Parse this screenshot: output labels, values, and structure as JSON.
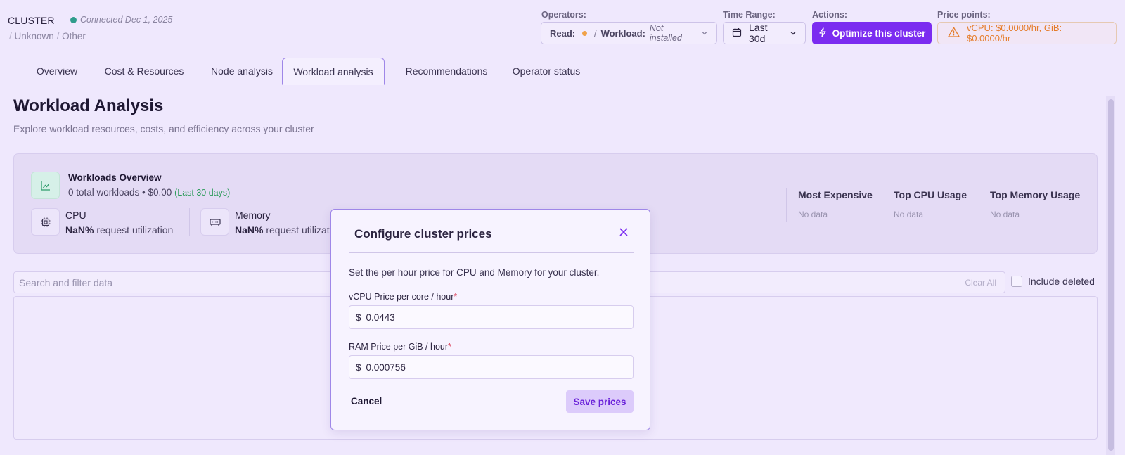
{
  "header": {
    "cluster_label": "CLUSTER",
    "connection_status": "Connected Dec 1, 2025",
    "breadcrumb": [
      "Unknown",
      "Other"
    ],
    "operators": {
      "label": "Operators:",
      "read_label": "Read:",
      "workload_label": "Workload:",
      "workload_value": "Not installed"
    },
    "time_range": {
      "label": "Time Range:",
      "value": "Last 30d"
    },
    "actions": {
      "label": "Actions:",
      "optimize_label": "Optimize this cluster"
    },
    "price_points": {
      "label": "Price points:",
      "value": "vCPU: $0.0000/hr, GiB: $0.0000/hr"
    }
  },
  "tabs": [
    {
      "label": "Overview"
    },
    {
      "label": "Cost & Resources"
    },
    {
      "label": "Node analysis"
    },
    {
      "label": "Workload analysis",
      "active": true
    },
    {
      "label": "Recommendations"
    },
    {
      "label": "Operator status"
    }
  ],
  "page": {
    "title": "Workload Analysis",
    "subtitle": "Explore workload resources, costs, and efficiency across your cluster"
  },
  "overview": {
    "title": "Workloads Overview",
    "summary": "0 total workloads • $0.00",
    "period": "(Last 30 days)",
    "cpu": {
      "label": "CPU",
      "value": "NaN%",
      "suffix": "request utilization"
    },
    "memory": {
      "label": "Memory",
      "value": "NaN%",
      "suffix": "request utilization"
    },
    "stats": [
      {
        "label": "Most Expensive",
        "value": "No data"
      },
      {
        "label": "Top CPU Usage",
        "value": "No data"
      },
      {
        "label": "Top Memory Usage",
        "value": "No data"
      }
    ]
  },
  "filter": {
    "placeholder": "Search and filter data",
    "clear_all": "Clear All",
    "include_deleted": "Include deleted"
  },
  "modal": {
    "title": "Configure cluster prices",
    "description": "Set the per hour price for CPU and Memory for your cluster.",
    "vcpu_label": "vCPU Price per core / hour",
    "vcpu_value": "0.0443",
    "ram_label": "RAM Price per GiB / hour",
    "ram_value": "0.000756",
    "currency": "$",
    "required_mark": "*",
    "cancel_label": "Cancel",
    "save_label": "Save prices"
  },
  "colors": {
    "accent": "#7b2cf0",
    "connected": "#2f9c8c",
    "warning": "#e57c2a",
    "operator_read": "#f0a24a"
  }
}
